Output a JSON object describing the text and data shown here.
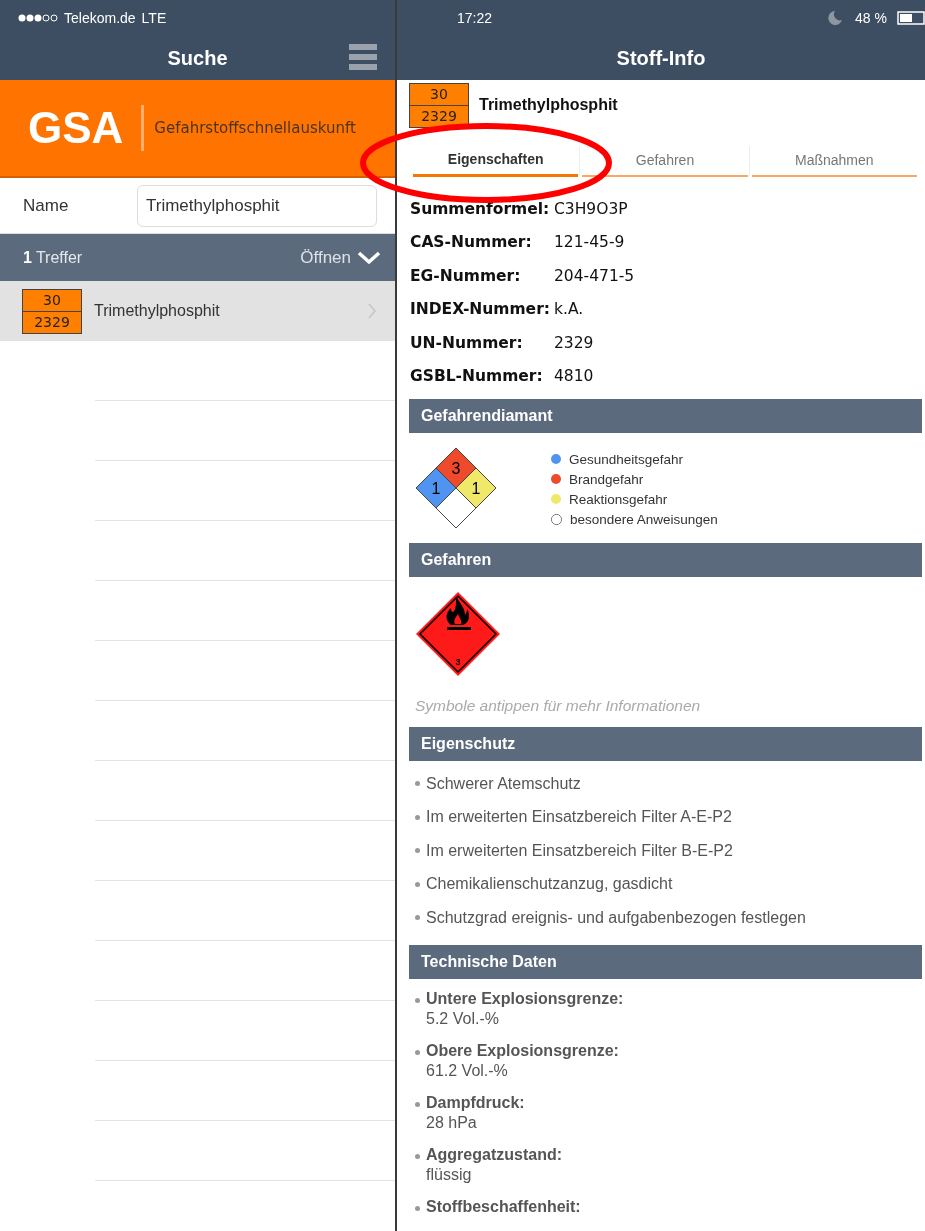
{
  "left_pane": {
    "status_bar": {
      "carrier": "Telekom.de",
      "network": "LTE"
    },
    "nav_title": "Suche",
    "banner": {
      "logo": "GSA",
      "subtitle": "Gefahrstoffschnellauskunft"
    },
    "search": {
      "label": "Name",
      "value": "Trimethylphosphit"
    },
    "results": {
      "count": "1",
      "label": "Treffer",
      "open": "Öffnen"
    },
    "items": [
      {
        "hazard_no": "30",
        "un_no": "2329",
        "name": "Trimethylphosphit",
        "selected": true
      }
    ]
  },
  "right_pane": {
    "status_bar": {
      "time": "17:22",
      "battery": "48 %"
    },
    "nav_title": "Stoff-Info",
    "substance": {
      "hazard_no": "30",
      "un_no": "2329",
      "name": "Trimethylphosphit"
    },
    "tabs": [
      {
        "label": "Eigenschaften",
        "selected": true
      },
      {
        "label": "Gefahren",
        "selected": false
      },
      {
        "label": "Maßnahmen",
        "selected": false
      }
    ],
    "properties": [
      {
        "label": "Summenformel:",
        "value": "C3H9O3P"
      },
      {
        "label": "CAS-Nummer:",
        "value": "121-45-9"
      },
      {
        "label": "EG-Nummer:",
        "value": "204-471-5"
      },
      {
        "label": "INDEX-Nummer:",
        "value": "k.A."
      },
      {
        "label": "UN-Nummer:",
        "value": "2329"
      },
      {
        "label": "GSBL-Nummer:",
        "value": "4810"
      }
    ],
    "sections": [
      {
        "kind": "diamond",
        "title": "Gefahrendiamant",
        "diamond": {
          "health": "1",
          "fire": "3",
          "reactivity": "1"
        },
        "legend": [
          {
            "label": "Gesundheitsgefahr",
            "color": "#4f94f0"
          },
          {
            "label": "Brandgefahr",
            "color": "#ee4a2b"
          },
          {
            "label": "Reaktionsgefahr",
            "color": "#f0e868"
          },
          {
            "label": "besondere Anweisungen",
            "color": "#ffffff"
          }
        ]
      },
      {
        "kind": "pictograms",
        "title": "Gefahren",
        "pictograms": [
          {
            "kind": "flame",
            "class_no": "3"
          }
        ],
        "note": "Symbole antippen für mehr Informationen"
      },
      {
        "kind": "list",
        "title": "Eigenschutz",
        "items": [
          "Schwerer Atemschutz",
          "Im erweiterten Einsatzbereich Filter A-E-P2",
          "Im erweiterten Einsatzbereich Filter B-E-P2",
          "Chemikalienschutzanzug, gasdicht",
          "Schutzgrad ereignis- und aufgabenbezogen festlegen"
        ]
      },
      {
        "kind": "data",
        "title": "Technische Daten",
        "items": [
          {
            "label": "Untere Explosionsgrenze:",
            "value": "5.2 Vol.-%"
          },
          {
            "label": "Obere Explosionsgrenze:",
            "value": "61.2 Vol.-%"
          },
          {
            "label": "Dampfdruck:",
            "value": "28 hPa"
          },
          {
            "label": "Aggregatzustand:",
            "value": "flüssig"
          },
          {
            "label": "Stoffbeschaffenheit:"
          }
        ]
      }
    ]
  },
  "annotation": {
    "color": "#ff0000"
  }
}
